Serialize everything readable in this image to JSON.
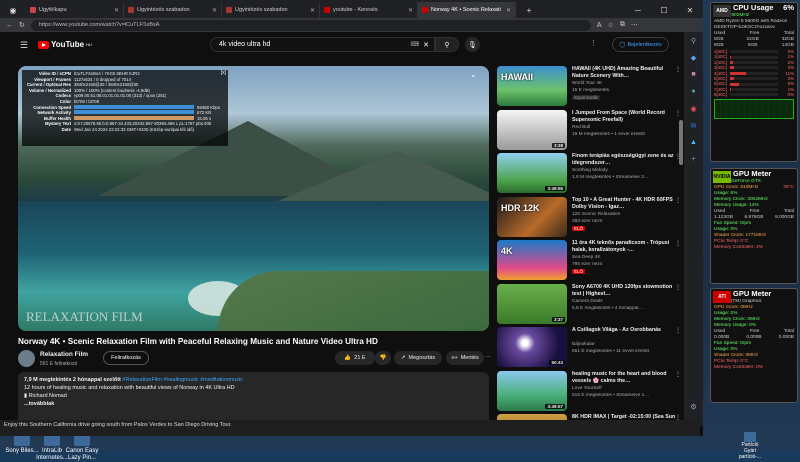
{
  "browser": {
    "tabs": [
      {
        "label": "Ügyfélkapu"
      },
      {
        "label": "Ügyintézés szabadon"
      },
      {
        "label": "Ügyintézés szabadon"
      },
      {
        "label": "youtube - Keresés"
      },
      {
        "label": "Norway 4K • Scenic Relaxati"
      }
    ],
    "url": "https://www.youtube.com/watch?v=lCuTLFSxBsA"
  },
  "youtube": {
    "logo_text": "YouTube",
    "logo_suffix": "HU",
    "search_value": "4k video ultra hd",
    "signin_label": "Bejelentkezés"
  },
  "player": {
    "watermark": "RELAXATION FILM",
    "stats": [
      {
        "k": "Video ID / sCPN",
        "v": "lCuTLFSxBsA / 7KG5 6BHR KJR3"
      },
      {
        "k": "Viewport / Frames",
        "v": "1127x634 / 0 dropped of 7014"
      },
      {
        "k": "Current / Optimal Res",
        "v": "3840x2160@30 / 3840x2160@30"
      },
      {
        "k": "Volume / Normalized",
        "v": "100% / 100% (content loudness -4.9dB)"
      },
      {
        "k": "Codecs",
        "v": "vp09.00.51.08.01.01.01.01.00 (313) / opus (251)"
      },
      {
        "k": "Color",
        "v": "bt709 / bt709"
      },
      {
        "k": "Connection Speed",
        "v": "59458 Kbps"
      },
      {
        "k": "Network Activity",
        "v": "672 KB"
      },
      {
        "k": "Buffer Health",
        "v": "15.05 s"
      },
      {
        "k": "Mystery Text",
        "v": "s:8 t:20578.55 b:0.967-34.433,20342.867-20394.466 L pL:1787 pbs:405"
      },
      {
        "k": "Date",
        "v": "Wed Jan 24 2024 22:22:33 GMT+0100 (Közép-európai téli idő)"
      }
    ]
  },
  "video": {
    "title": "Norway 4K • Scenic Relaxation Film with Peaceful Relaxing Music and Nature Video Ultra HD",
    "channel": "Relaxation Film",
    "subscribers": "561 E feliratkozó",
    "subscribe_label": "Feliratkozás",
    "likes": "21 E",
    "share_label": "Megosztás",
    "save_label": "Mentés",
    "views_meta": "7,9 M megtekintés  2 hónappal ezelőtt",
    "hashtags": "#RelaxationFilm #healingmusic #meditationmusic",
    "desc_line": "12 hours of healing music and relaxation with beautiful views of Norway in 4K Ultra HD",
    "desc_author": "Richard Nomad",
    "more_label": "...továbbiak"
  },
  "recommendations": [
    {
      "title": "HAWAII (4K UHD) Amazing Beautiful Nature Scenery With…",
      "channel": "World Tour 4K",
      "stats": "15 E megtekintés",
      "badge": "Szponzorált",
      "duration": "",
      "thumb_text": "HAWAII",
      "bg": "linear-gradient(180deg,#3b8fd0,#6cc26a 60%,#2a7a3a)"
    },
    {
      "title": "I Jumped From Space (World Record Supersonic Freefall)",
      "channel": "Red Bull",
      "stats": "19 M megtekintés • 1 évvel ezelőtt",
      "badge": "",
      "duration": "3:38",
      "thumb_text": "",
      "bg": "linear-gradient(180deg,#f4f4f4,#9a9a9a)"
    },
    {
      "title": "Finom terápiás egészségügyi zene és az idegrendszer…",
      "channel": "Soothing Melody",
      "stats": "1,8 M megtekintés • Streamelve 3…",
      "badge": "",
      "duration": "3:49:55",
      "thumb_text": "",
      "bg": "linear-gradient(180deg,#8fd0f0,#4aa34a 70%,#2a6a2a)"
    },
    {
      "title": "Top 10 • A Great Hunter - 4K HDR 60FPS Dolby Vision - Igaz…",
      "channel": "12K Scenic Relaxation",
      "stats": "383 ezer néző",
      "badge": "ÉLŐ",
      "duration": "",
      "thumb_text": "HDR 12K",
      "bg": "linear-gradient(135deg,#1a1a1a,#b86a2a 60%,#3a2a1a)"
    },
    {
      "title": "11 óra 4K teknős paradicsom - Trópusi halak, korallzátonyok -…",
      "channel": "Sea Deep 4K",
      "stats": "785 ezer néző",
      "badge": "ÉLŐ",
      "duration": "",
      "thumb_text": "4K",
      "bg": "linear-gradient(180deg,#1a7ac8,#e04a8a 70%,#f0a030)"
    },
    {
      "title": "Sony A6700 4K UHD 120fps slowmotion test | Highest…",
      "channel": "Camera Deals",
      "stats": "5,8 E megtekintés • 4 hónappal…",
      "badge": "",
      "duration": "3:37",
      "thumb_text": "",
      "bg": "linear-gradient(180deg,#6ab04a,#3a7a2a)"
    },
    {
      "title": "A Csillagok Világa - Az Ősrobbanás",
      "channel": "Bájnokalar",
      "stats": "651 E megtekintés • 11 évvel ezelőtt",
      "badge": "",
      "duration": "50:43",
      "thumb_text": "",
      "bg": "radial-gradient(circle at 40% 40%,#fff 0 6%,#6a4aa0 20%,#1a1040 70%)"
    },
    {
      "title": "healing music for the heart and blood vessels 🌸 calms the…",
      "channel": "Love YourSelf",
      "stats": "516 E megtekintés • Streamelve 1…",
      "badge": "",
      "duration": "3:49:57",
      "thumb_text": "",
      "bg": "linear-gradient(180deg,#8ac8f0,#4ab07a 60%,#2a7a4a)"
    },
    {
      "title": "8K HDR IMAX | Target -02:15:00 (Sea Sun Kingdom) | Dolby 5.1",
      "channel": "",
      "stats": "",
      "badge": "",
      "duration": "",
      "thumb_text": "8K",
      "bg": "linear-gradient(180deg,#d0a040,#6a4a20)"
    }
  ],
  "statusbar_text": "Enjoy this Southern California drive going south from Palos Verdes to San Diego Driving Tour.",
  "cpu_gadget": {
    "title": "CPU Usage",
    "percent": "6%",
    "model": "AMD Ryzen 5 5600G with Radeon",
    "clock": "Clock: 3901MHz",
    "host": "DESKTOP-5JIKSCO\\uzukov",
    "headers": [
      "Used",
      "Free",
      "Total"
    ],
    "cores": [
      {
        "label": "1[40C]",
        "pct": "0%"
      },
      {
        "label": "1[40C]",
        "pct": "1%"
      },
      {
        "label": "2[40C]",
        "pct": "2%"
      },
      {
        "label": "3[40C]",
        "pct": "3%"
      },
      {
        "label": "4[40C]",
        "pct": "11%"
      },
      {
        "label": "5[40C]",
        "pct": "3%"
      },
      {
        "label": "6[40C]",
        "pct": "6%"
      },
      {
        "label": "7[40C]",
        "pct": "1%"
      },
      {
        "label": "8[40C]",
        "pct": "0%"
      }
    ],
    "core_levels": [
      0,
      0.01,
      0.02,
      0.03,
      0.11,
      0.03,
      0.06,
      0.01,
      0
    ],
    "mem_rows": [
      {
        "a": "8GB",
        "b": "22GB",
        "c": "32GB"
      },
      {
        "a": "8GB",
        "b": "6GB",
        "c": "14GB"
      }
    ]
  },
  "gpu_gadget_1": {
    "title": "GPU Meter",
    "brand": "NVIDIA",
    "model": "NVIDIA GeForce GTX",
    "clock": "GPU Clock: 810MHz",
    "temp": "38°C",
    "usage": "Usage: 6%",
    "mem_clock": "Memory Clock: 3002MHz",
    "mem_usage": "Memory Usage: 14%",
    "headers": [
      "Used",
      "Free",
      "Total"
    ],
    "mem_vals": [
      "1.123GB",
      "6.876GB",
      "8.000GB"
    ],
    "fan": "Fan Speed: 0rpm",
    "fan_usage": "Usage: 0%",
    "shader": "Shader Clock: 1771MHz",
    "pcie": "PCIe Temp: 0°C",
    "memctrl": "Memory Controller: 2%"
  },
  "gpu_gadget_2": {
    "title": "GPU Meter",
    "brand": "ATI",
    "model": "Radeon(TM) Graphics",
    "clock": "GPU Clock: 0MHz",
    "usage": "Usage: 0%",
    "mem_clock": "Memory Clock: 0MHz",
    "mem_usage": "Memory Usage: 0%",
    "headers": [
      "Used",
      "Free",
      "Total"
    ],
    "mem_vals": [
      "0.000B",
      "0.000B",
      "0.000B"
    ],
    "fan": "Fan Speed: 0rpm",
    "fan_usage": "Usage: 0%",
    "shader": "Shader Clock: 0MHz",
    "pcie": "PCIe Temp: 0°C",
    "memctrl": "Memory Controller: 0%"
  },
  "desktop_icons": [
    {
      "label": "IntraLib Internetes..."
    },
    {
      "label": "Canon Easy Lazy Pin..."
    },
    {
      "label": "Sony Biles..."
    },
    {
      "label": "Partíció Gyári partíció-..."
    }
  ],
  "colors": {
    "accent": "#3ea6ff",
    "yt_red": "#ff0000"
  }
}
